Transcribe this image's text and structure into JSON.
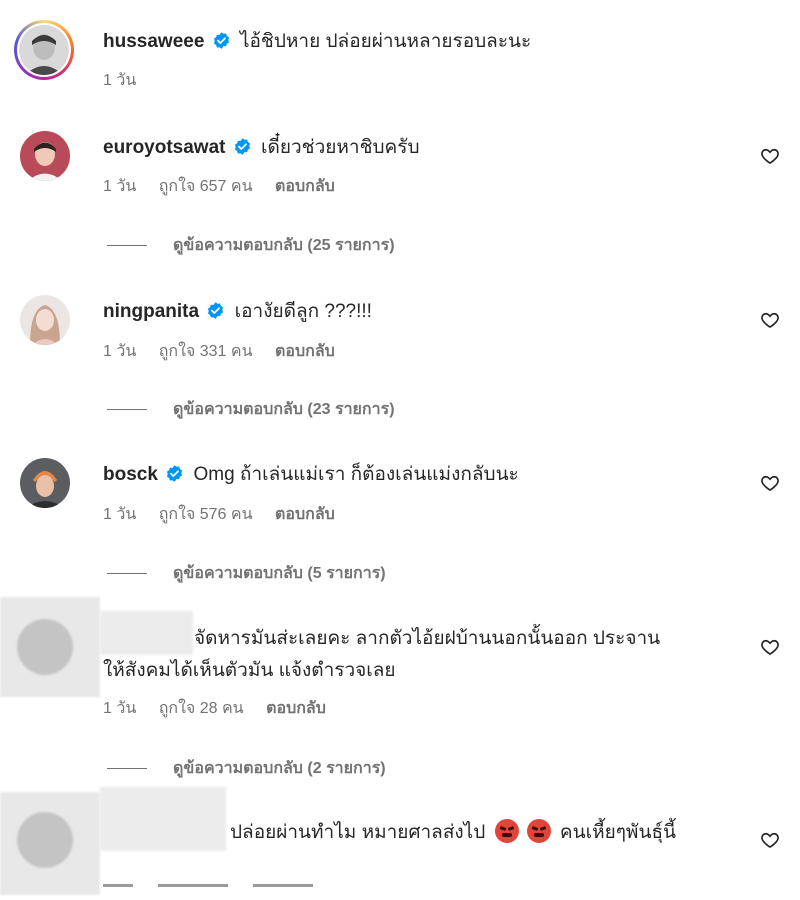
{
  "comments": [
    {
      "username": "hussaweee",
      "verified": true,
      "text": "ไอ้ชิปหาย ปล่อยผ่านหลายรอบละนะ",
      "time": "1 วัน",
      "likes": "",
      "reply": "",
      "view_replies": ""
    },
    {
      "username": "euroyotsawat",
      "verified": true,
      "text": "เดี๋ยวช่วยหาชิบครับ",
      "time": "1 วัน",
      "likes": "ถูกใจ 657 คน",
      "reply": "ตอบกลับ",
      "view_replies": "ดูข้อความตอบกลับ (25 รายการ)"
    },
    {
      "username": "ningpanita",
      "verified": true,
      "text": "เอางัยดีลูก ???!!!",
      "time": "1 วัน",
      "likes": "ถูกใจ 331 คน",
      "reply": "ตอบกลับ",
      "view_replies": "ดูข้อความตอบกลับ (23 รายการ)"
    },
    {
      "username": "bosck",
      "verified": true,
      "text": "Omg ถ้าเล่นแม่เรา ก็ต้องเล่นแม่งกลับนะ",
      "time": "1 วัน",
      "likes": "ถูกใจ 576 คน",
      "reply": "ตอบกลับ",
      "view_replies": "ดูข้อความตอบกลับ (5 รายการ)"
    },
    {
      "username": "",
      "verified": false,
      "text_line1": "จัดหารมันส่ะเลยคะ ลากตัวไอ้ยฝบ้านนอกนั้นออก ประจาน",
      "text_line2": "ให้สังคมได้เห็นตัวมัน แจ้งตำรวจเลย",
      "time": "1 วัน",
      "likes": "ถูกใจ 28 คน",
      "reply": "ตอบกลับ",
      "view_replies": "ดูข้อความตอบกลับ (2 รายการ)"
    },
    {
      "username": "",
      "verified": false,
      "text_before_emoji": "ปล่อยผ่านทำไม หมายศาลส่งไป",
      "text_after_emoji": "คนเหี้ยๆพันธุ์นี้"
    }
  ],
  "icons": {
    "verified_color": "#0095f6",
    "heart": "heart-outline-icon",
    "emoji": "angry-face-emoji"
  }
}
